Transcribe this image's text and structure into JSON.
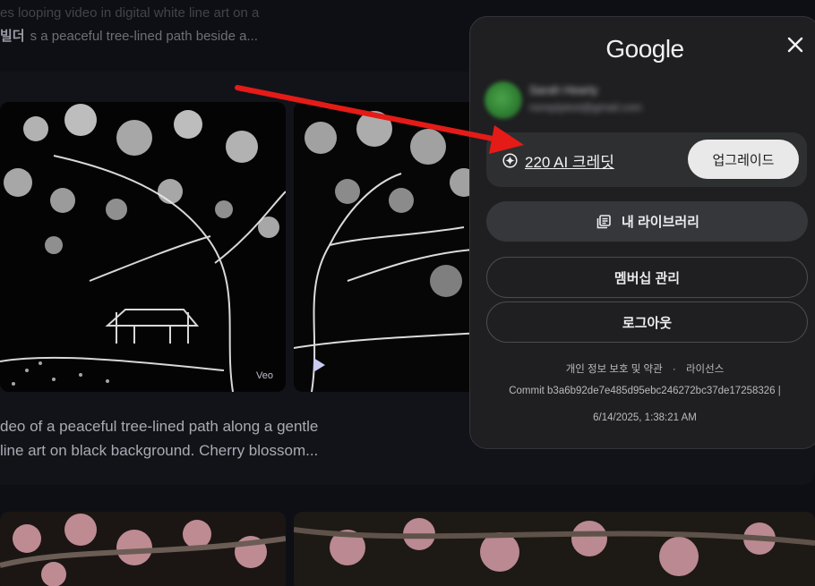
{
  "background": {
    "top_line1": "es looping video in digital white line art on a",
    "top_tag": "빌더",
    "top_line2": "s a peaceful tree-lined path beside a...",
    "badge": "Veo",
    "description": {
      "line1": "deo of a peaceful tree-lined path along a gentle",
      "line2": "line art on black background. Cherry blossom..."
    }
  },
  "popup": {
    "logo": "Google",
    "account": {
      "name": "Sarah Hearty",
      "email": "noreplytest@gmail.com"
    },
    "credits_label": "220 AI 크레딧",
    "upgrade_label": "업그레이드",
    "library_label": "내 라이브러리",
    "membership_label": "멤버십 관리",
    "logout_label": "로그아웃",
    "footer": {
      "privacy_label": "개인 정보 보호 및 약관",
      "separator": "·",
      "license_label": "라이선스",
      "commit": "Commit b3a6b92de7e485d95ebc246272bc37de17258326 |",
      "date": "6/14/2025, 1:38:21 AM"
    }
  },
  "icons": {
    "close": "close-icon",
    "credit": "sparkle-circle-icon",
    "library": "library-stack-icon",
    "play": "play-icon"
  },
  "colors": {
    "panel_bg": "#1f1f21",
    "arrow": "#e41b17",
    "upgrade_bg": "#e9e9ea"
  }
}
